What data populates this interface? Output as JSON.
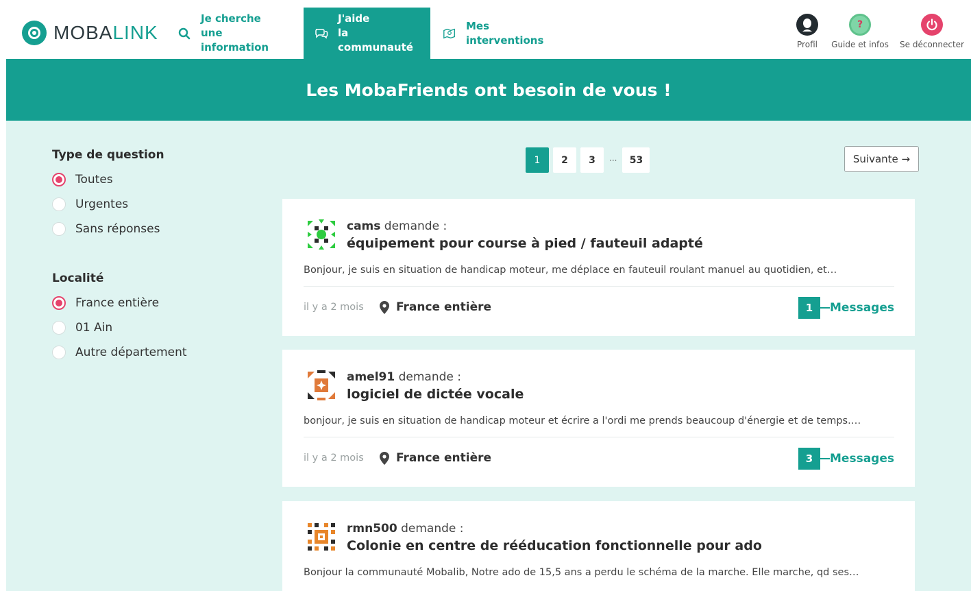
{
  "brand": {
    "part1": "MOBA",
    "part2": "LINK"
  },
  "nav": [
    {
      "line1": "Je cherche",
      "line2": "une information"
    },
    {
      "line1": "J'aide",
      "line2": "la communauté"
    },
    {
      "line1": "Mes",
      "line2": "interventions"
    }
  ],
  "header_buttons": {
    "profile": "Profil",
    "guide": "Guide et infos",
    "guide_symbol": "?",
    "logout": "Se déconnecter"
  },
  "banner": {
    "title": "Les MobaFriends ont besoin de vous !"
  },
  "filters": {
    "type": {
      "title": "Type de question",
      "options": [
        "Toutes",
        "Urgentes",
        "Sans réponses"
      ],
      "selected": "Toutes"
    },
    "locality": {
      "title": "Localité",
      "options": [
        "France entière",
        "01 Ain",
        "Autre département"
      ],
      "selected": "France entière"
    }
  },
  "pagination": {
    "pages": [
      "1",
      "2",
      "3"
    ],
    "ellipsis": "···",
    "last": "53",
    "current": "1",
    "next_label": "Suivante →"
  },
  "questions": [
    {
      "user": "cams",
      "verb": "demande :",
      "title": "équipement pour course à pied / fauteuil adapté",
      "excerpt": "Bonjour, je suis en situation de handicap moteur, me déplace en fauteuil roulant manuel au quotidien, et…",
      "time": "il y a 2 mois",
      "location": "France entière",
      "messages_count": "1",
      "messages_label": "Messages",
      "avatar_color": "#2ecc40"
    },
    {
      "user": "amel91",
      "verb": "demande :",
      "title": "logiciel de dictée vocale",
      "excerpt": "bonjour,  je suis en situation de handicap moteur et écrire a l'ordi me prends beaucoup d'énergie et de temps.…",
      "time": "il y a 2 mois",
      "location": "France entière",
      "messages_count": "3",
      "messages_label": "Messages",
      "avatar_color": "#e07a3a"
    },
    {
      "user": "rmn500",
      "verb": "demande :",
      "title": "Colonie en centre de rééducation fonctionnelle pour ado",
      "excerpt": "Bonjour la communauté Mobalib, Notre ado de 15,5 ans a perdu le schéma de la marche. Elle marche, qd ses…",
      "avatar_color": "#e8862a"
    }
  ],
  "colors": {
    "teal": "#159f91",
    "pink": "#e5436c",
    "background": "#dff4f1"
  }
}
